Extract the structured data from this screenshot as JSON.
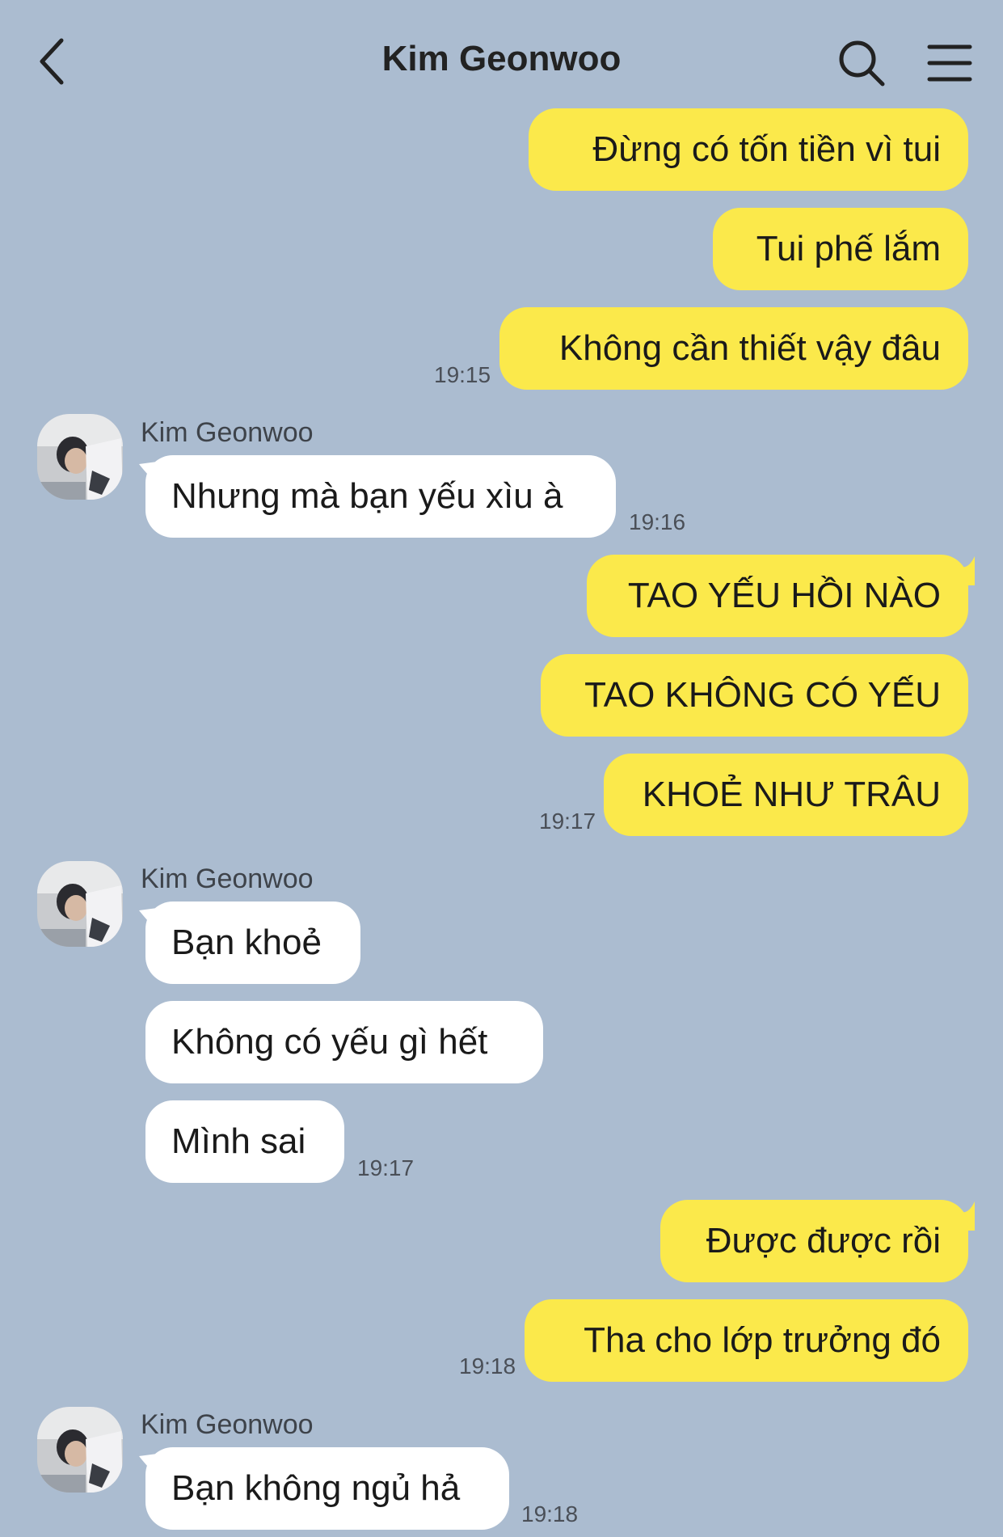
{
  "header": {
    "title": "Kim Geonwoo"
  },
  "icons": {
    "back": "chevron-left-icon",
    "search": "search-icon",
    "menu": "hamburger-menu-icon"
  },
  "colors": {
    "background": "#abbcd0",
    "my_bubble": "#fbe94b",
    "their_bubble": "#ffffff"
  },
  "messages": {
    "m1": "Đừng có tốn tiền vì tui",
    "m2": "Tui phế lắm",
    "m3": "Không cần thiết vậy đâu",
    "m4": "Nhưng mà bạn yếu xìu à",
    "m5": "TAO YẾU HỒI NÀO",
    "m6": "TAO KHÔNG CÓ YẾU",
    "m7": "KHOẺ NHƯ TRÂU",
    "m8": "Bạn khoẻ",
    "m9": "Không có yếu gì hết",
    "m10": "Mình sai",
    "m11": "Được được rồi",
    "m12": "Tha cho lớp trưởng đó",
    "m13": "Bạn không ngủ hả"
  },
  "times": {
    "t1": "19:15",
    "t2": "19:16",
    "t3": "19:17",
    "t4": "19:17",
    "t5": "19:18",
    "t6": "19:18"
  },
  "senders": {
    "s1": "Kim Geonwoo",
    "s2": "Kim Geonwoo",
    "s3": "Kim Geonwoo"
  }
}
